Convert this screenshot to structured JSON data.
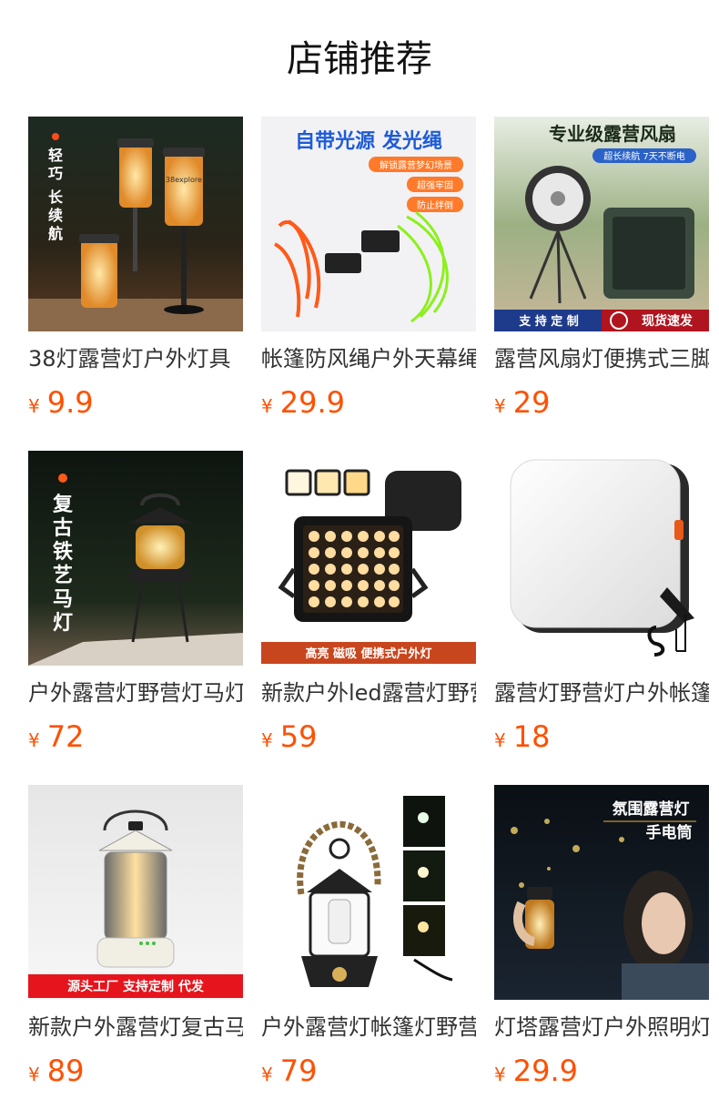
{
  "header": {
    "title": "店铺推荐"
  },
  "currency_symbol": "¥",
  "colors": {
    "price": "#ff5000",
    "title": "#111111",
    "name": "#333333"
  },
  "products": [
    {
      "name": "38灯露营灯户外灯具",
      "price": "9.9",
      "image_text": [
        "轻",
        "巧",
        "长",
        "续",
        "航"
      ],
      "image_text_2": "38explore",
      "icon": "lantern-image"
    },
    {
      "name": "帐篷防风绳户外天幕绳",
      "price": "29.9",
      "image_text": "自带光源 发光绳",
      "badges": [
        "解锁露营梦幻场景",
        "超强牢固",
        "防止绊倒"
      ],
      "icon": "glow-rope-image"
    },
    {
      "name": "露营风扇灯便携式三脚架",
      "price": "29",
      "image_text": "专业级露营风扇",
      "badge": "超长续航 7天不断电",
      "bottom_left": "支 持 定 制",
      "bottom_right": "现货速发",
      "icon": "camping-fan-image"
    },
    {
      "name": "户外露营灯野营灯马灯",
      "price": "72",
      "image_text": [
        "复",
        "古",
        "铁",
        "艺",
        "马",
        "灯"
      ],
      "icon": "retro-lantern-image"
    },
    {
      "name": "新款户外led露营灯野营灯",
      "price": "59",
      "bottom_text": "高亮 磁吸 便携式户外灯",
      "icon": "led-panel-light-image"
    },
    {
      "name": "露营灯野营灯户外帐篷灯",
      "price": "18",
      "icon": "square-lamp-image"
    },
    {
      "name": "新款户外露营灯复古马灯",
      "price": "89",
      "bottom_text": "源头工厂 支持定制 代发",
      "icon": "vintage-lantern-image"
    },
    {
      "name": "户外露营灯帐篷灯野营灯",
      "price": "79",
      "icon": "rope-lantern-image"
    },
    {
      "name": "灯塔露营灯户外照明灯",
      "price": "29.9",
      "image_text": "氛围露营灯",
      "image_text_2": "手电筒",
      "icon": "tower-light-image"
    }
  ]
}
